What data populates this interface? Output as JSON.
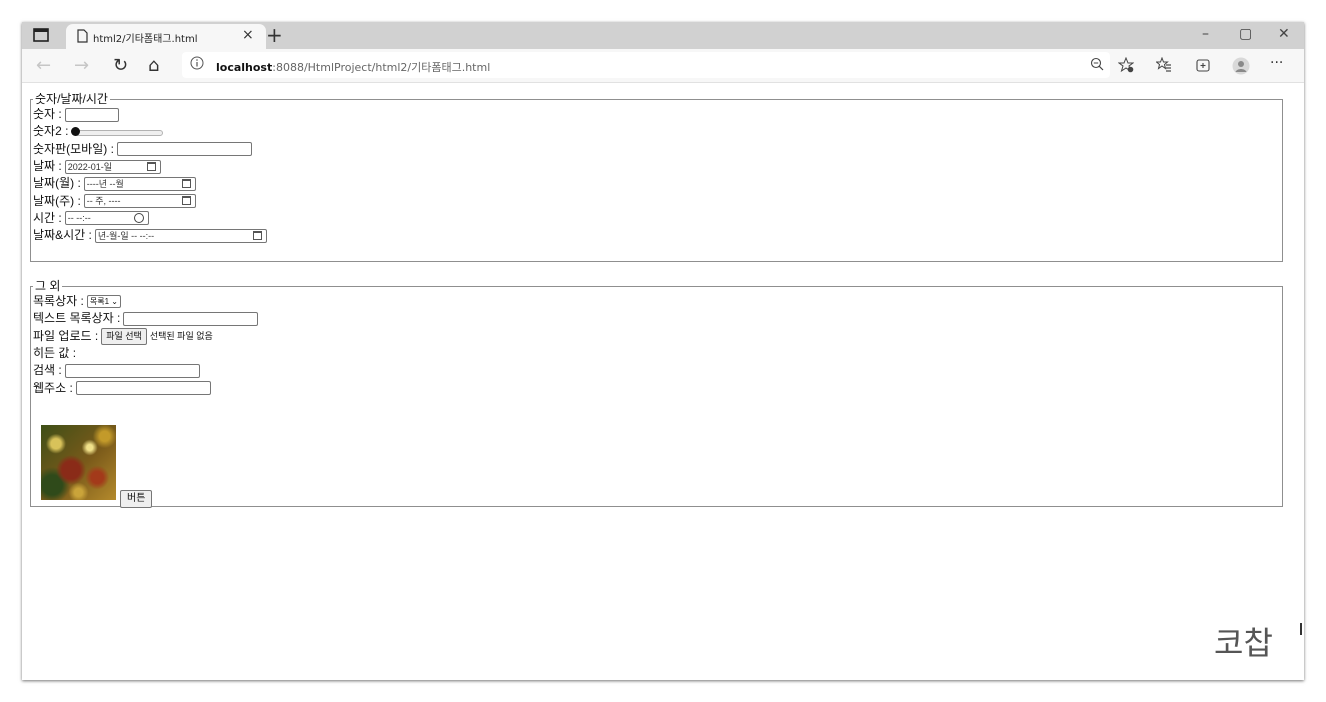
{
  "browser": {
    "tab_title": "html2/기타폼태그.html",
    "tab_close": "×",
    "new_tab": "+",
    "window_controls": {
      "minimize": "–",
      "restore": "▢",
      "close": "✕"
    },
    "url_host": "localhost",
    "url_rest": ":8088/HtmlProject/html2/기타폼태그.html",
    "nav": {
      "back": "←",
      "forward": "→",
      "refresh": "↻",
      "home": "⌂"
    },
    "toolbar_icons": [
      "zoom-icon",
      "favorite-add-icon",
      "favorites-icon",
      "collections-icon",
      "profile-icon",
      "more-icon"
    ],
    "more": "···"
  },
  "fieldset1": {
    "legend": "숫자/날짜/시간",
    "number_label": "숫자 :",
    "range_label": "숫자2 :",
    "range_value": 0,
    "tel_label": "숫자판(모바일) :",
    "date_label": "날짜 :",
    "date_value": "2022-01-일",
    "month_label": "날짜(월) :",
    "month_value": "----년 --월",
    "week_label": "날짜(주) :",
    "week_value": "-- 주, ----",
    "time_label": "시간 :",
    "time_value": "-- --:--",
    "datetime_label": "날짜&시간 :",
    "datetime_value": "년-월-일  -- --:--"
  },
  "fieldset2": {
    "legend": "그 외",
    "select_label": "목록상자 :",
    "select_value": "목록1",
    "datalist_label": "텍스트 목록상자 :",
    "file_label": "파일 업로드 :",
    "file_button": "파일 선택",
    "file_status": "선택된 파일 없음",
    "hidden_label": "히든 값 :",
    "search_label": "검색 :",
    "url_label": "웹주소 :",
    "button_label": "버튼"
  },
  "watermark": "코찹"
}
